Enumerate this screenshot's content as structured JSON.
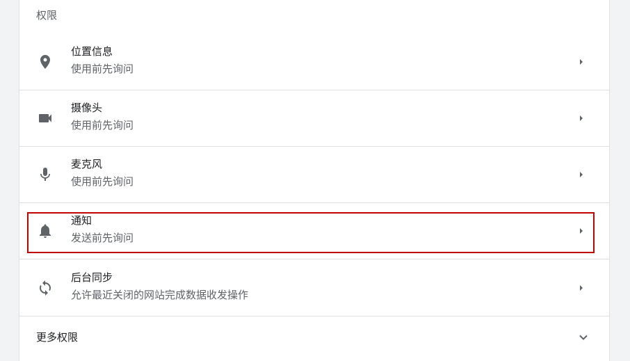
{
  "section": {
    "title": "权限"
  },
  "permissions": [
    {
      "icon": "location-pin-icon",
      "title": "位置信息",
      "subtitle": "使用前先询问"
    },
    {
      "icon": "camera-icon",
      "title": "摄像头",
      "subtitle": "使用前先询问"
    },
    {
      "icon": "microphone-icon",
      "title": "麦克风",
      "subtitle": "使用前先询问"
    },
    {
      "icon": "bell-icon",
      "title": "通知",
      "subtitle": "发送前先询问"
    },
    {
      "icon": "sync-icon",
      "title": "后台同步",
      "subtitle": "允许最近关闭的网站完成数据收发操作"
    }
  ],
  "more": {
    "label": "更多权限",
    "icon": "chevron-down-icon"
  },
  "colors": {
    "icon": "#5f6368",
    "highlight": "#c00000"
  }
}
